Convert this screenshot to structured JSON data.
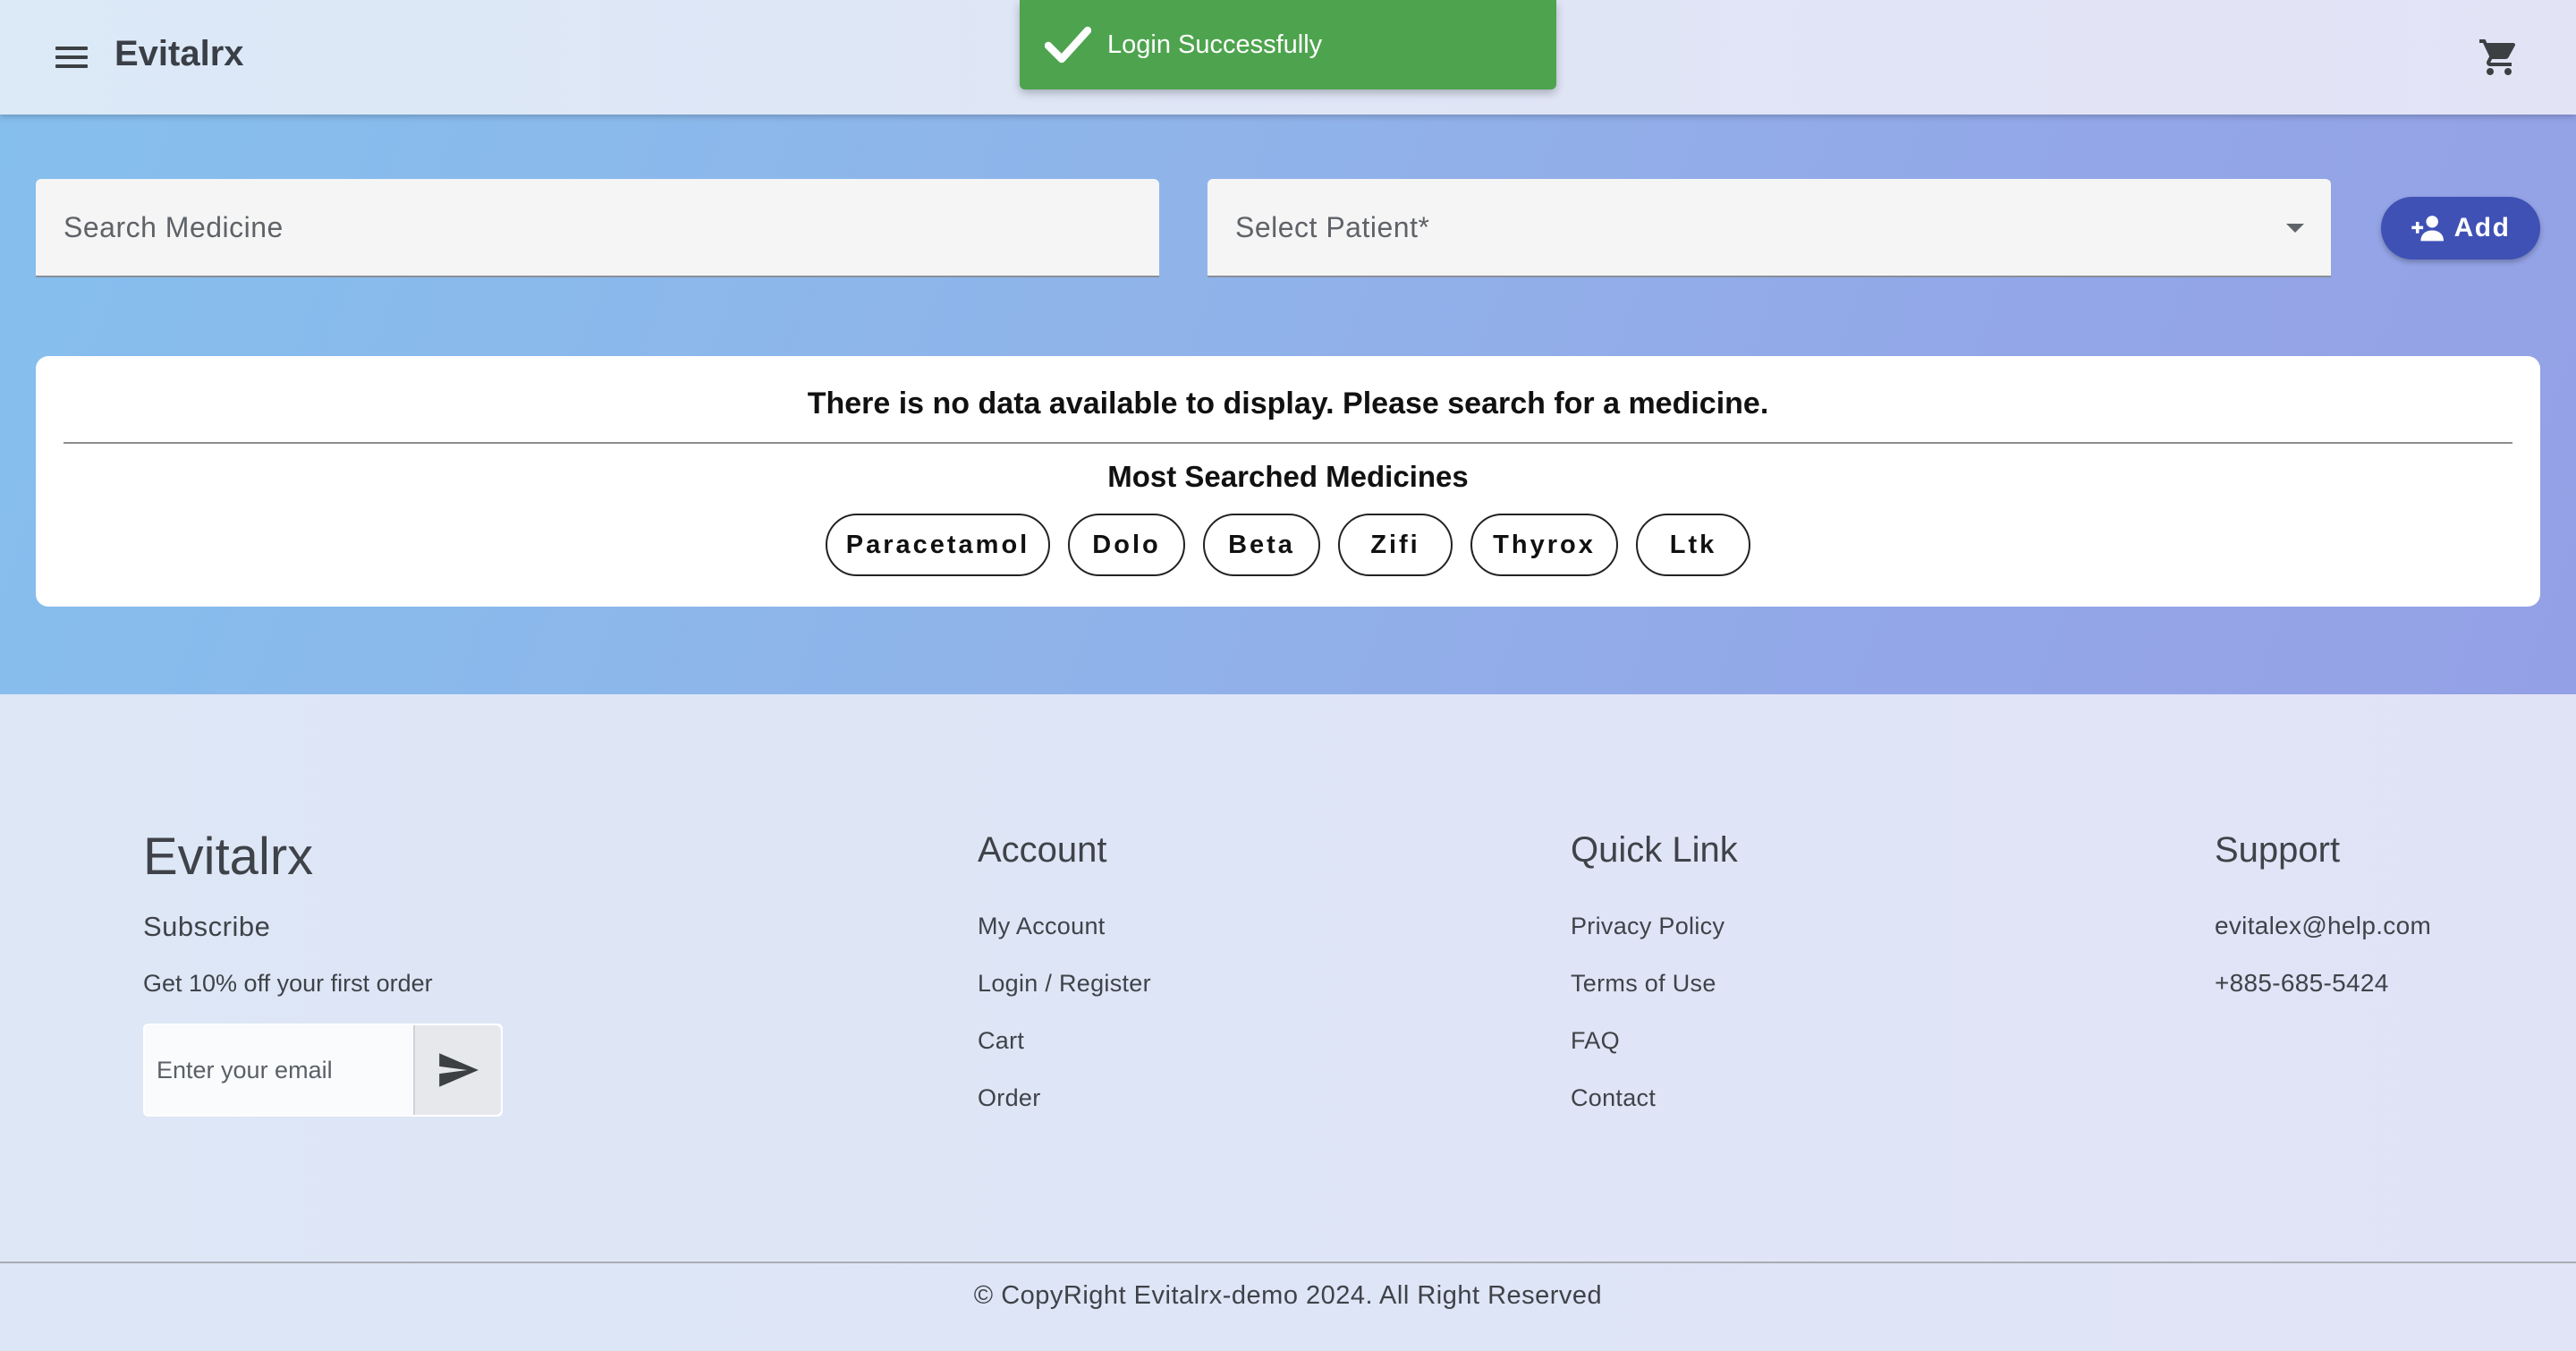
{
  "header": {
    "brand": "Evitalrx",
    "menu_icon": "menu-icon",
    "cart_icon": "shopping-cart-icon"
  },
  "toast": {
    "message": "Login Successfully",
    "icon": "check-icon",
    "color": "#4ea34e"
  },
  "search": {
    "placeholder": "Search Medicine",
    "value": ""
  },
  "patient_select": {
    "label": "Select Patient*",
    "selected": ""
  },
  "add_button": {
    "label": "Add",
    "icon": "person-add-icon",
    "color": "#3f51b5"
  },
  "results": {
    "empty_message": "There is no data available to display. Please search for a medicine.",
    "most_searched_title": "Most Searched Medicines",
    "chips": [
      "Paracetamol",
      "Dolo",
      "Beta",
      "Zifi",
      "Thyrox",
      "Ltk"
    ]
  },
  "footer": {
    "brand": "Evitalrx",
    "subscribe_title": "Subscribe",
    "subscribe_text": "Get 10% off your first order",
    "email_placeholder": "Enter your email",
    "send_icon": "send-icon",
    "account": {
      "title": "Account",
      "links": [
        "My Account",
        "Login / Register",
        "Cart",
        "Order"
      ]
    },
    "quick_link": {
      "title": "Quick Link",
      "links": [
        "Privacy Policy",
        "Terms of Use",
        "FAQ",
        "Contact"
      ]
    },
    "support": {
      "title": "Support",
      "email": "evitalex@help.com",
      "phone": "+885-685-5424"
    },
    "copyright": "© CopyRight Evitalrx-demo 2024. All Right Reserved"
  }
}
